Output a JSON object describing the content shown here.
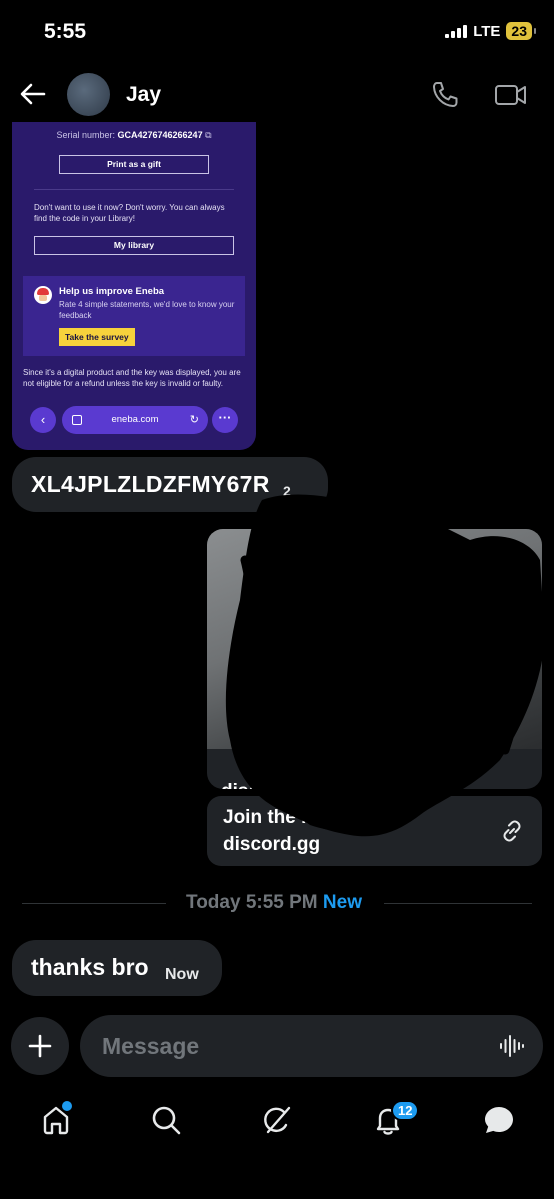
{
  "status_bar": {
    "time": "5:55",
    "network": "LTE",
    "battery": "23"
  },
  "header": {
    "contact_name": "Jay"
  },
  "shared_screenshot": {
    "serial_label": "Serial number:",
    "serial_value": "GCA4276746266247",
    "print_gift_label": "Print as a gift",
    "dont_want_text": "Don't want to use it now? Don't worry. You can always find the code in your Library!",
    "library_label": "My library",
    "survey_title": "Help us improve Eneba",
    "survey_desc": "Rate 4 simple statements, we'd love to know your feedback",
    "survey_button": "Take the survey",
    "refund_text": "Since it's a digital product and the key was displayed, you are not eligible for a refund unless the key is invalid or faulty.",
    "browser_url": "eneba.com"
  },
  "messages": {
    "code_text": "XL4JPLZLDZFMY67R",
    "code_time": "2",
    "link_preview_title": "Join the",
    "link_preview_domain": "discord.gg",
    "link_card_title": "Join the          hete gr...",
    "link_card_domain": "discord.gg"
  },
  "divider": {
    "label": "Today 5:55 PM",
    "new_label": "New"
  },
  "reply": {
    "text": "thanks bro",
    "time": "Now"
  },
  "composer": {
    "placeholder": "Message"
  },
  "tabbar": {
    "notifications_count": "12"
  },
  "colors": {
    "accent": "#1d9bf0",
    "bubble": "#202327",
    "eneba_purple": "#2a1a6b",
    "survey_yellow": "#f7d23c"
  }
}
